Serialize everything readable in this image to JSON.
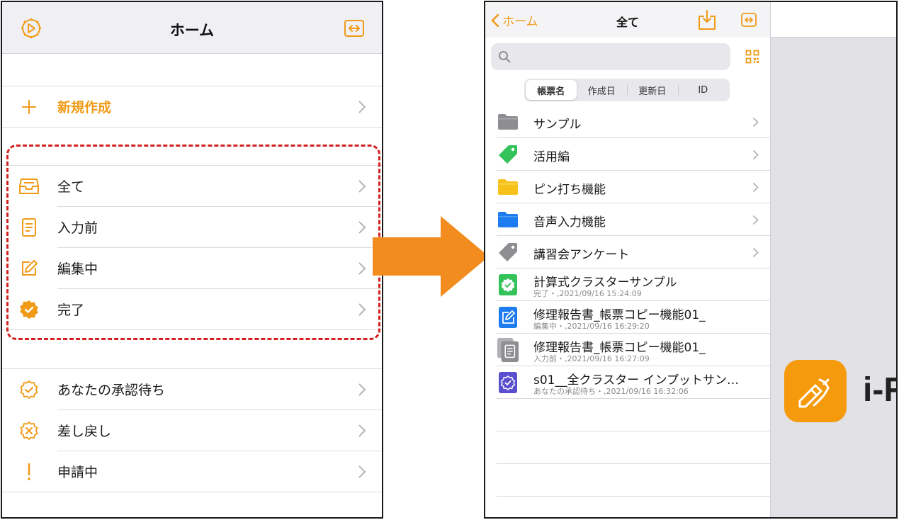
{
  "colors": {
    "accent": "#f09a15",
    "highlight": "#d42020",
    "arrow": "#f28c1e",
    "logo": "#f49a0c"
  },
  "left": {
    "title": "ホーム",
    "new_item": "新規作成",
    "status_items": [
      {
        "label": "全て",
        "icon": "inbox-icon"
      },
      {
        "label": "入力前",
        "icon": "document-icon"
      },
      {
        "label": "編集中",
        "icon": "edit-icon"
      },
      {
        "label": "完了",
        "icon": "check-badge-icon"
      }
    ],
    "approval_items": [
      {
        "label": "あなたの承認待ち",
        "icon": "check-seal-icon"
      },
      {
        "label": "差し戻し",
        "icon": "x-seal-icon"
      },
      {
        "label": "申請中",
        "icon": "exclamation-icon"
      }
    ]
  },
  "right": {
    "back_label": "ホーム",
    "title": "全て",
    "segments": [
      "帳票名",
      "作成日",
      "更新日",
      "ID"
    ],
    "folders": [
      {
        "label": "サンプル",
        "icon": "gray-folder-icon"
      },
      {
        "label": "活用編",
        "icon": "green-tag-icon"
      },
      {
        "label": "ピン打ち機能",
        "icon": "yellow-folder-icon"
      },
      {
        "label": "音声入力機能",
        "icon": "blue-folder-icon"
      },
      {
        "label": "講習会アンケート",
        "icon": "gray-tag-icon"
      }
    ],
    "documents": [
      {
        "title": "計算式クラスターサンプル",
        "sub": "完了・,2021/09/16 15:24:09",
        "icon": "complete-doc-icon"
      },
      {
        "title": "修理報告書_帳票コピー機能01_",
        "sub": "編集中・,2021/09/16 16:29:20",
        "icon": "editing-doc-icon"
      },
      {
        "title": "修理報告書_帳票コピー機能01_",
        "sub": "入力前・,2021/09/16 16:27:09",
        "icon": "pending-doc-icon"
      },
      {
        "title": "s01__全クラスター インプットサン…",
        "sub": "あなたの承認待ち・,2021/09/16 16:32:06",
        "icon": "approval-doc-icon"
      }
    ],
    "app_name": "i-R"
  }
}
